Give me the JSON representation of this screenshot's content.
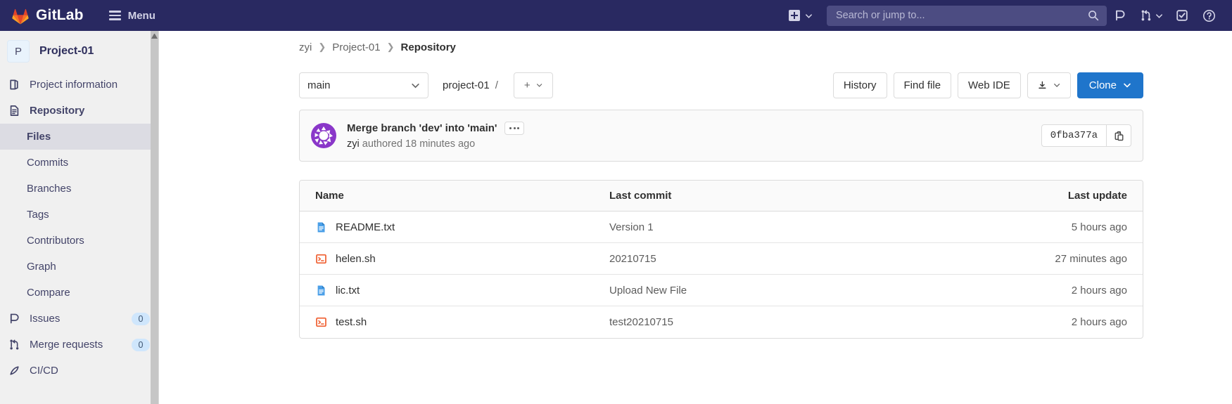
{
  "topnav": {
    "brand": "GitLab",
    "menu_label": "Menu",
    "create_icon": "plus-square-icon",
    "create_caret_icon": "chevron-down-icon",
    "search": {
      "placeholder": "Search or jump to...",
      "value": "",
      "icon": "search-icon"
    },
    "icons": [
      {
        "name": "issues-icon",
        "label": "Issues"
      },
      {
        "name": "merge-request-icon",
        "label": "Merge requests",
        "caret": "chevron-down-icon"
      },
      {
        "name": "todos-icon",
        "label": "To-Do List"
      },
      {
        "name": "help-icon",
        "label": "Help"
      }
    ]
  },
  "sidebar": {
    "avatar_initial": "P",
    "project_name": "Project-01",
    "items": [
      {
        "label": "Project information",
        "icon": "book-icon",
        "type": "top"
      },
      {
        "label": "Repository",
        "icon": "doc-text-icon",
        "type": "top",
        "active": true
      },
      {
        "label": "Files",
        "type": "sub",
        "active": true
      },
      {
        "label": "Commits",
        "type": "sub"
      },
      {
        "label": "Branches",
        "type": "sub"
      },
      {
        "label": "Tags",
        "type": "sub"
      },
      {
        "label": "Contributors",
        "type": "sub"
      },
      {
        "label": "Graph",
        "type": "sub"
      },
      {
        "label": "Compare",
        "type": "sub"
      },
      {
        "label": "Issues",
        "icon": "issues-icon",
        "type": "top",
        "badge": "0"
      },
      {
        "label": "Merge requests",
        "icon": "merge-request-icon",
        "type": "top",
        "badge": "0"
      },
      {
        "label": "CI/CD",
        "icon": "rocket-icon",
        "type": "top"
      }
    ]
  },
  "breadcrumb": [
    {
      "label": "zyi"
    },
    {
      "label": "Project-01"
    },
    {
      "label": "Repository",
      "current": true
    }
  ],
  "toolbar": {
    "branch": "main",
    "branch_caret_icon": "chevron-down-icon",
    "path": "project-01",
    "path_separator": "/",
    "add_label": "+",
    "add_caret_icon": "chevron-down-icon",
    "history_label": "History",
    "find_file_label": "Find file",
    "web_ide_label": "Web IDE",
    "download_icon": "download-icon",
    "download_caret_icon": "chevron-down-icon",
    "clone_label": "Clone",
    "clone_caret_icon": "chevron-down-icon",
    "clone_color": "#1f75cb"
  },
  "commit": {
    "avatar_icon": "identicon",
    "title": "Merge branch 'dev' into 'main'",
    "more_icon": "ellipsis-icon",
    "author": "zyi",
    "meta": "authored 18 minutes ago",
    "sha": "0fba377a",
    "copy_icon": "clipboard-icon"
  },
  "filetable": {
    "headers": {
      "name": "Name",
      "last_commit": "Last commit",
      "last_update": "Last update"
    },
    "rows": [
      {
        "name": "README.txt",
        "icon": "text-file-icon",
        "icon_color": "#4a9fe8",
        "last_commit": "Version 1",
        "last_update": "5 hours ago"
      },
      {
        "name": "helen.sh",
        "icon": "shell-script-icon",
        "icon_color": "#f0663a",
        "last_commit": "20210715",
        "last_update": "27 minutes ago"
      },
      {
        "name": "lic.txt",
        "icon": "text-file-icon",
        "icon_color": "#4a9fe8",
        "last_commit": "Upload New File",
        "last_update": "2 hours ago"
      },
      {
        "name": "test.sh",
        "icon": "shell-script-icon",
        "icon_color": "#f0663a",
        "last_commit": "test20210715",
        "last_update": "2 hours ago"
      }
    ]
  }
}
